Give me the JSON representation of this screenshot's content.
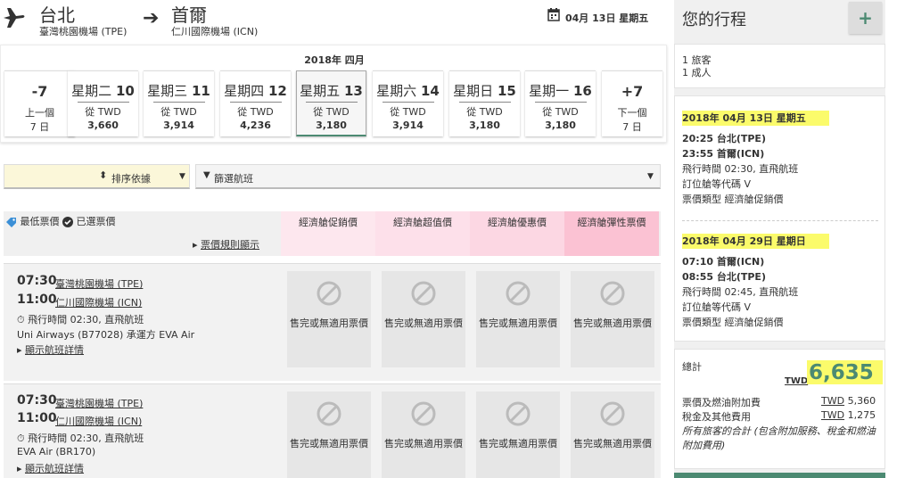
{
  "header": {
    "origin_city": "台北",
    "origin_airport": "臺灣桃園機場 (TPE)",
    "dest_city": "首爾",
    "dest_airport": "仁川國際機場 (ICN)",
    "date": "04月 13日 星期五"
  },
  "date_strip": {
    "month": "2018年 四月",
    "prev": {
      "big": "-7",
      "line1": "上一個",
      "line2": "7 日"
    },
    "next": {
      "big": "+7",
      "line1": "下一個",
      "line2": "7 日"
    },
    "days": [
      {
        "weekday": "星期二",
        "num": "10",
        "from": "從 TWD",
        "price": "3,660",
        "selected": false
      },
      {
        "weekday": "星期三",
        "num": "11",
        "from": "從 TWD",
        "price": "3,914",
        "selected": false
      },
      {
        "weekday": "星期四",
        "num": "12",
        "from": "從 TWD",
        "price": "4,236",
        "selected": false
      },
      {
        "weekday": "星期五",
        "num": "13",
        "from": "從 TWD",
        "price": "3,180",
        "selected": true
      },
      {
        "weekday": "星期六",
        "num": "14",
        "from": "從 TWD",
        "price": "3,914",
        "selected": false
      },
      {
        "weekday": "星期日",
        "num": "15",
        "from": "從 TWD",
        "price": "3,180",
        "selected": false
      },
      {
        "weekday": "星期一",
        "num": "16",
        "from": "從 TWD",
        "price": "3,180",
        "selected": false
      }
    ]
  },
  "controls": {
    "sort_label": "排序依據",
    "filter_label": "篩選航班"
  },
  "table_header": {
    "lowest_fare": "最低票價",
    "selected_fare": "已選票價",
    "fare_rules": "票價規則顯示",
    "fare_classes": [
      "經濟艙促銷價",
      "經濟艙超值價",
      "經濟艙優惠價",
      "經濟艙彈性票價"
    ]
  },
  "flights": [
    {
      "dep_time": "07:30",
      "dep_airport": "臺灣桃園機場 (TPE)",
      "arr_time": "11:00",
      "arr_airport": "仁川國際機場 (ICN)",
      "duration": "飛行時間 02:30, 直飛航班",
      "airline": "Uni Airways (B77028) 承運方 EVA Air",
      "details": "顯示航班詳情",
      "fares": [
        "售完或無適用票價",
        "售完或無適用票價",
        "售完或無適用票價",
        "售完或無適用票價"
      ]
    },
    {
      "dep_time": "07:30",
      "dep_airport": "臺灣桃園機場 (TPE)",
      "arr_time": "11:00",
      "arr_airport": "仁川國際機場 (ICN)",
      "duration": "飛行時間 02:30, 直飛航班",
      "airline": "EVA Air (BR170)",
      "details": "顯示航班詳情",
      "fares": [
        "售完或無適用票價",
        "售完或無適用票價",
        "售完或無適用票價",
        "售完或無適用票價"
      ]
    }
  ],
  "itinerary": {
    "title": "您的行程",
    "plus": "+",
    "pax_line1": "1 旅客",
    "pax_line2": "1 成人",
    "segments": [
      {
        "date": "2018年 04月 13日 星期五",
        "dep": "20:25 台北(TPE)",
        "arr": "23:55 首爾(ICN)",
        "duration": "飛行時間 02:30, 直飛航班",
        "booking_class": "訂位艙等代碼 V",
        "fare_type": "票價類型 經濟艙促銷價"
      },
      {
        "date": "2018年 04月 29日 星期日",
        "dep": "07:10 首爾(ICN)",
        "arr": "08:55 台北(TPE)",
        "duration": "飛行時間 02:45, 直飛航班",
        "booking_class": "訂位艙等代碼 V",
        "fare_type": "票價類型 經濟艙促銷價"
      }
    ],
    "total_label": "總計",
    "currency": "TWD",
    "total_amount": "6,635",
    "fare_label": "票價及燃油附加費",
    "fare_value_cur": "TWD",
    "fare_value": "5,360",
    "tax_label": "稅金及其他費用",
    "tax_value_cur": "TWD",
    "tax_value": "1,275",
    "note": "所有旅客的合計 (包含附加服務、稅金和燃油附加費用)"
  },
  "colors": {
    "accent": "#4c8a72",
    "highlight": "#fbfb6b",
    "pink1": "#fde7ee",
    "pink4": "#fbc2d3"
  }
}
